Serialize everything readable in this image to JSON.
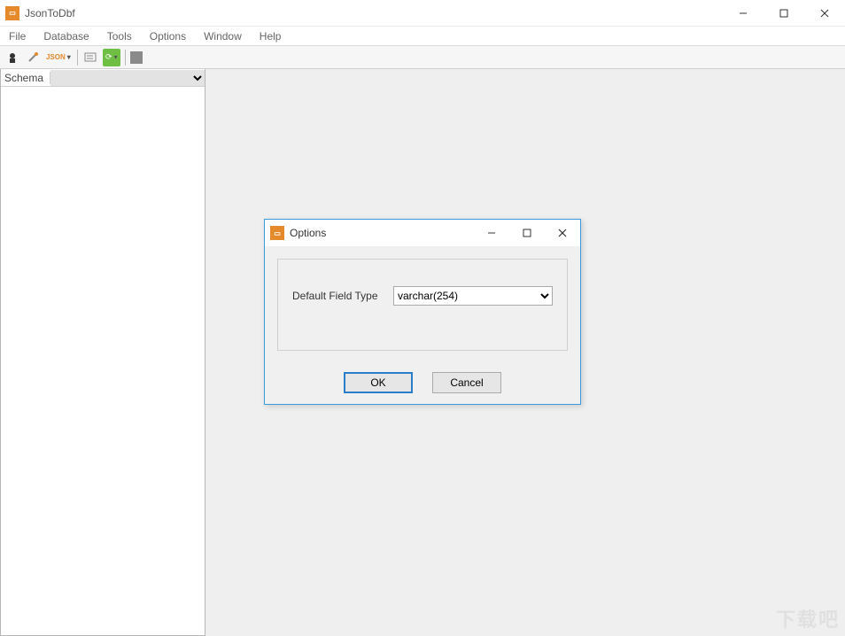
{
  "window": {
    "title": "JsonToDbf",
    "icon_name": "app-icon"
  },
  "menubar": [
    "File",
    "Database",
    "Tools",
    "Options",
    "Window",
    "Help"
  ],
  "toolbar": {
    "items": [
      {
        "name": "wizard-icon"
      },
      {
        "name": "connect-icon"
      },
      {
        "name": "json-icon",
        "label": "JSON"
      },
      {
        "name": "query-icon"
      },
      {
        "name": "export-icon"
      },
      {
        "name": "stop-icon"
      }
    ]
  },
  "sidebar": {
    "schema_label": "Schema",
    "schema_value": ""
  },
  "dialog": {
    "title": "Options",
    "field_label": "Default Field Type",
    "field_value": "varchar(254)",
    "ok_label": "OK",
    "cancel_label": "Cancel"
  },
  "watermark": "下载吧"
}
